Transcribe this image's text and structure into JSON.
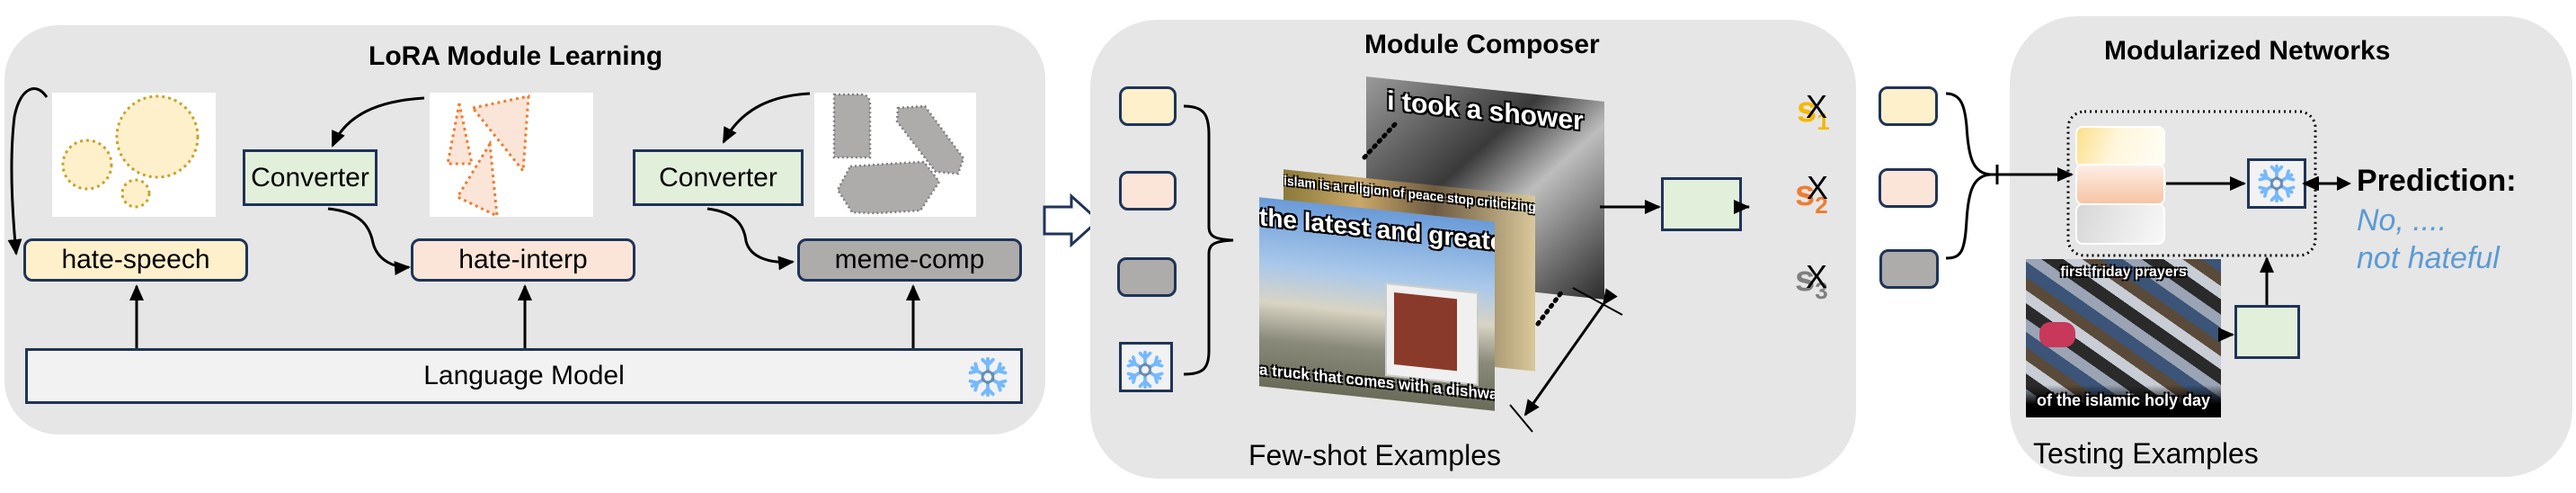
{
  "panels": {
    "lora": {
      "title": "LoRA Module Learning",
      "converter_label": "Converter",
      "modules": [
        {
          "label": "hate-speech",
          "color": "#fff0cc"
        },
        {
          "label": "hate-interp",
          "color": "#fbe5d8"
        },
        {
          "label": "meme-comp",
          "color": "#aeabab"
        }
      ],
      "base_model_label": "Language Model",
      "frozen_icon": "snowflake-icon"
    },
    "composer": {
      "title": "Module Composer",
      "module_colors": [
        "#fff0cc",
        "#fbe5d8",
        "#aeabab"
      ],
      "frozen_icon": "snowflake-icon",
      "examples": [
        {
          "top_text": "i took a shower",
          "bottom_text": ""
        },
        {
          "top_text": "islam is a religion of peace  stop criticizing my religion",
          "bottom_text": ""
        },
        {
          "top_text": "the latest and greatest.",
          "bottom_text": "a truck that comes with a dishwasher!"
        }
      ],
      "ellipsis": "......",
      "caption": "Few-shot Examples"
    },
    "weights": [
      {
        "symbol": "s",
        "index": "1",
        "color": "#f5b800"
      },
      {
        "symbol": "s",
        "index": "2",
        "color": "#ed7d31"
      },
      {
        "symbol": "s",
        "index": "3",
        "color": "#7f7f7f"
      }
    ],
    "multiply_symbol": "X",
    "sum_symbol": "+",
    "network": {
      "title": "Modularized Networks",
      "prediction_title": "Prediction:",
      "prediction_line1": "No, ....",
      "prediction_line2": "not hateful",
      "prediction_color": "#5b9bd5",
      "test_example": {
        "top_text": "first friday prayers",
        "bottom_text": "of the islamic holy day"
      },
      "caption": "Testing Examples"
    }
  }
}
